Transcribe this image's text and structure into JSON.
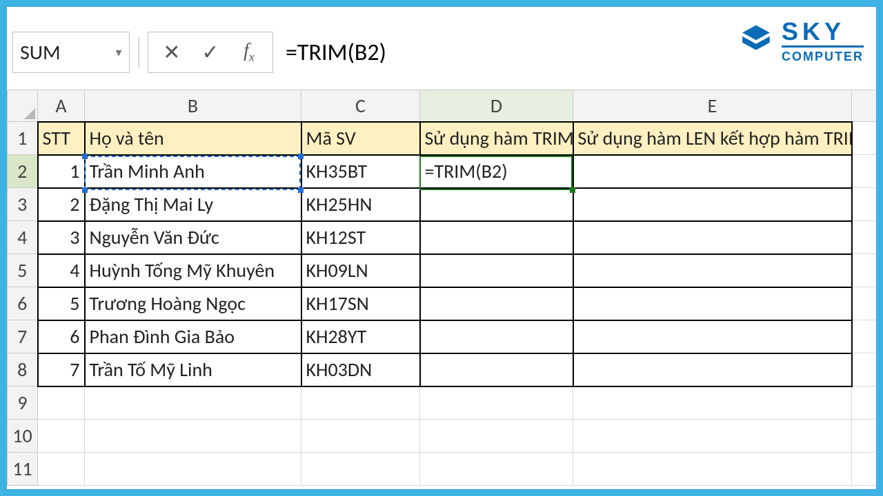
{
  "name_box": "SUM",
  "formula_bar": "=TRIM(B2)",
  "logo": {
    "line1": "SKY",
    "line2": "COMPUTER"
  },
  "columns": [
    "A",
    "B",
    "C",
    "D",
    "E"
  ],
  "header_row": {
    "A": "STT",
    "B": "Họ và tên",
    "C": "Mã SV",
    "D": "Sử dụng hàm TRIM",
    "E": "Sử dụng hàm LEN kết hợp hàm TRIM"
  },
  "active_cell_value": "=TRIM(B2)",
  "rows": [
    {
      "n": 1,
      "A": "1",
      "B": "Trần    Minh    Anh",
      "C": "KH35BT"
    },
    {
      "n": 2,
      "A": "2",
      "B": "Đặng Thị   Mai   Ly",
      "C": "KH25HN"
    },
    {
      "n": 3,
      "A": "3",
      "B": "Nguyễn    Văn Đức",
      "C": "KH12ST"
    },
    {
      "n": 4,
      "A": "4",
      "B": "Huỳnh Tống Mỹ    Khuyên",
      "C": "KH09LN"
    },
    {
      "n": 5,
      "A": "5",
      "B": "Trương    Hoàng Ngọc",
      "C": "KH17SN"
    },
    {
      "n": 6,
      "A": "6",
      "B": "Phan Đình   Gia Bảo",
      "C": "KH28YT"
    },
    {
      "n": 7,
      "A": "7",
      "B": "Trần   Tố Mỹ Linh",
      "C": "KH03DN"
    }
  ],
  "empty_rows": [
    9,
    10,
    11
  ]
}
